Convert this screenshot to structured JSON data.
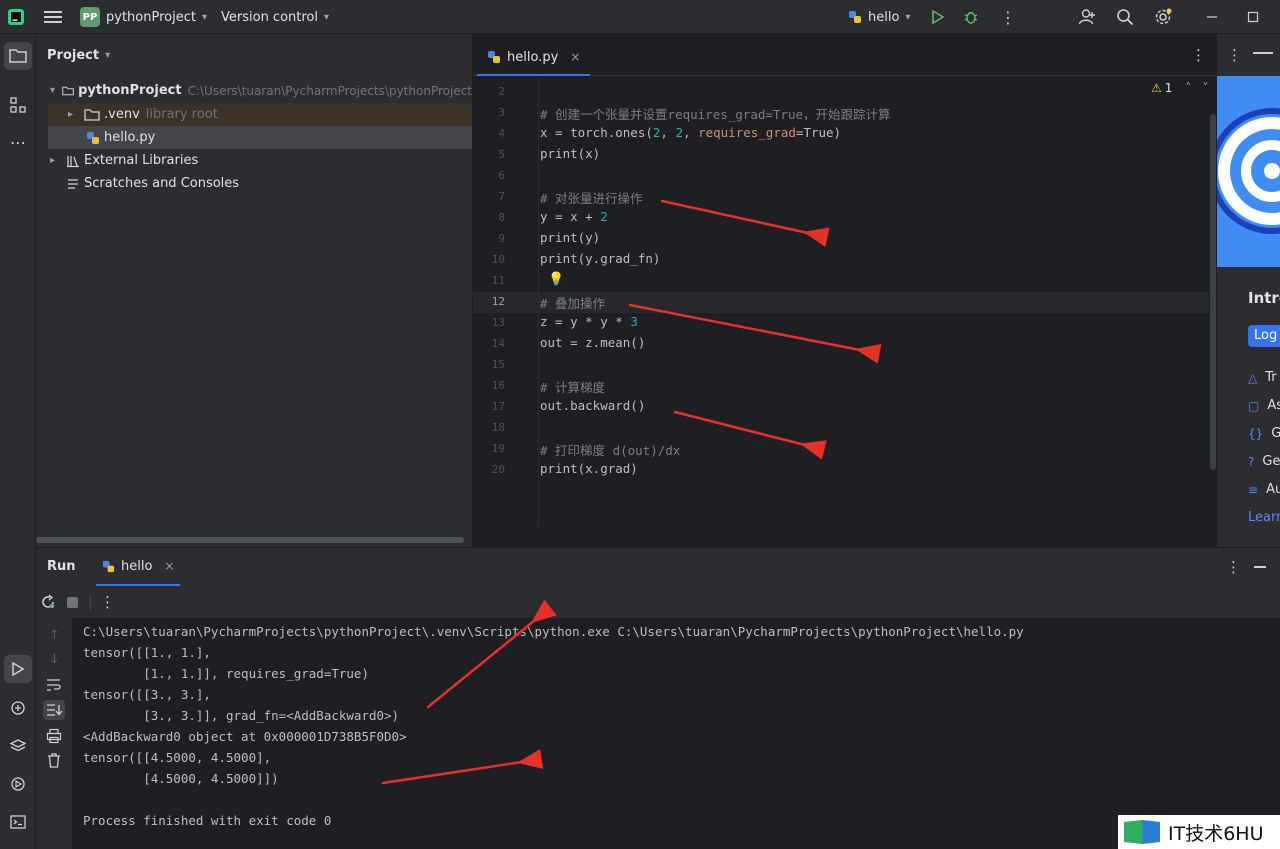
{
  "titlebar": {
    "project_badge": "PP",
    "project_name": "pythonProject",
    "vcs_label": "Version control",
    "run_config": "hello"
  },
  "project_panel": {
    "title": "Project",
    "root_name": "pythonProject",
    "root_path": "C:\\Users\\tuaran\\PycharmProjects\\pythonProject",
    "venv_name": ".venv",
    "venv_hint": "library root",
    "file_name": "hello.py",
    "external_libraries": "External Libraries",
    "scratches": "Scratches and Consoles"
  },
  "editor": {
    "tab_label": "hello.py",
    "warning_count": "1",
    "lines": [
      {
        "n": "2",
        "parts": []
      },
      {
        "n": "3",
        "parts": [
          {
            "t": "# 创建一个张量并设置requires_grad=True，开始跟踪计算",
            "c": "cm"
          }
        ]
      },
      {
        "n": "4",
        "parts": [
          {
            "t": "x = torch.ones(",
            "c": ""
          },
          {
            "t": "2",
            "c": "num"
          },
          {
            "t": ", ",
            "c": ""
          },
          {
            "t": "2",
            "c": "num"
          },
          {
            "t": ", ",
            "c": ""
          },
          {
            "t": "requires_grad",
            "c": "kw"
          },
          {
            "t": "=True)",
            "c": ""
          }
        ]
      },
      {
        "n": "5",
        "parts": [
          {
            "t": "print(x)",
            "c": ""
          }
        ]
      },
      {
        "n": "6",
        "parts": []
      },
      {
        "n": "7",
        "parts": [
          {
            "t": "# 对张量进行操作",
            "c": "cm"
          }
        ]
      },
      {
        "n": "8",
        "parts": [
          {
            "t": "y = x + ",
            "c": ""
          },
          {
            "t": "2",
            "c": "num"
          }
        ]
      },
      {
        "n": "9",
        "parts": [
          {
            "t": "print(y)",
            "c": ""
          }
        ]
      },
      {
        "n": "10",
        "parts": [
          {
            "t": "print(y.grad_fn)",
            "c": ""
          }
        ]
      },
      {
        "n": "11",
        "parts": []
      },
      {
        "n": "12",
        "parts": [
          {
            "t": "# 叠加操作",
            "c": "cm"
          }
        ]
      },
      {
        "n": "13",
        "parts": [
          {
            "t": "z = y * y * ",
            "c": ""
          },
          {
            "t": "3",
            "c": "num"
          }
        ]
      },
      {
        "n": "14",
        "parts": [
          {
            "t": "out = z.mean()",
            "c": ""
          }
        ]
      },
      {
        "n": "15",
        "parts": []
      },
      {
        "n": "16",
        "parts": [
          {
            "t": "# 计算梯度",
            "c": "cm"
          }
        ]
      },
      {
        "n": "17",
        "parts": [
          {
            "t": "out.backward()",
            "c": ""
          }
        ]
      },
      {
        "n": "18",
        "parts": []
      },
      {
        "n": "19",
        "parts": [
          {
            "t": "# 打印梯度 d(out)/dx",
            "c": "cm"
          }
        ]
      },
      {
        "n": "20",
        "parts": [
          {
            "t": "print(x.grad)",
            "c": ""
          }
        ]
      }
    ],
    "current_line": "12"
  },
  "right_panel": {
    "heading": "Intro",
    "login_button": "Log",
    "items": [
      "Tr",
      "As",
      "Ge",
      "Ge",
      "Au"
    ],
    "learn_link": "Learn"
  },
  "run_panel": {
    "title": "Run",
    "tab_label": "hello",
    "console_lines": [
      "C:\\Users\\tuaran\\PycharmProjects\\pythonProject\\.venv\\Scripts\\python.exe C:\\Users\\tuaran\\PycharmProjects\\pythonProject\\hello.py",
      "tensor([[1., 1.],",
      "        [1., 1.]], requires_grad=True)",
      "tensor([[3., 3.],",
      "        [3., 3.]], grad_fn=<AddBackward0>)",
      "<AddBackward0 object at 0x000001D738B5F0D0>",
      "tensor([[4.5000, 4.5000],",
      "        [4.5000, 4.5000]])",
      "",
      "Process finished with exit code 0"
    ]
  },
  "watermark": {
    "text": "IT技术6HU"
  },
  "colors": {
    "accent": "#3574f0",
    "annotation_arrow": "#e8302a"
  }
}
